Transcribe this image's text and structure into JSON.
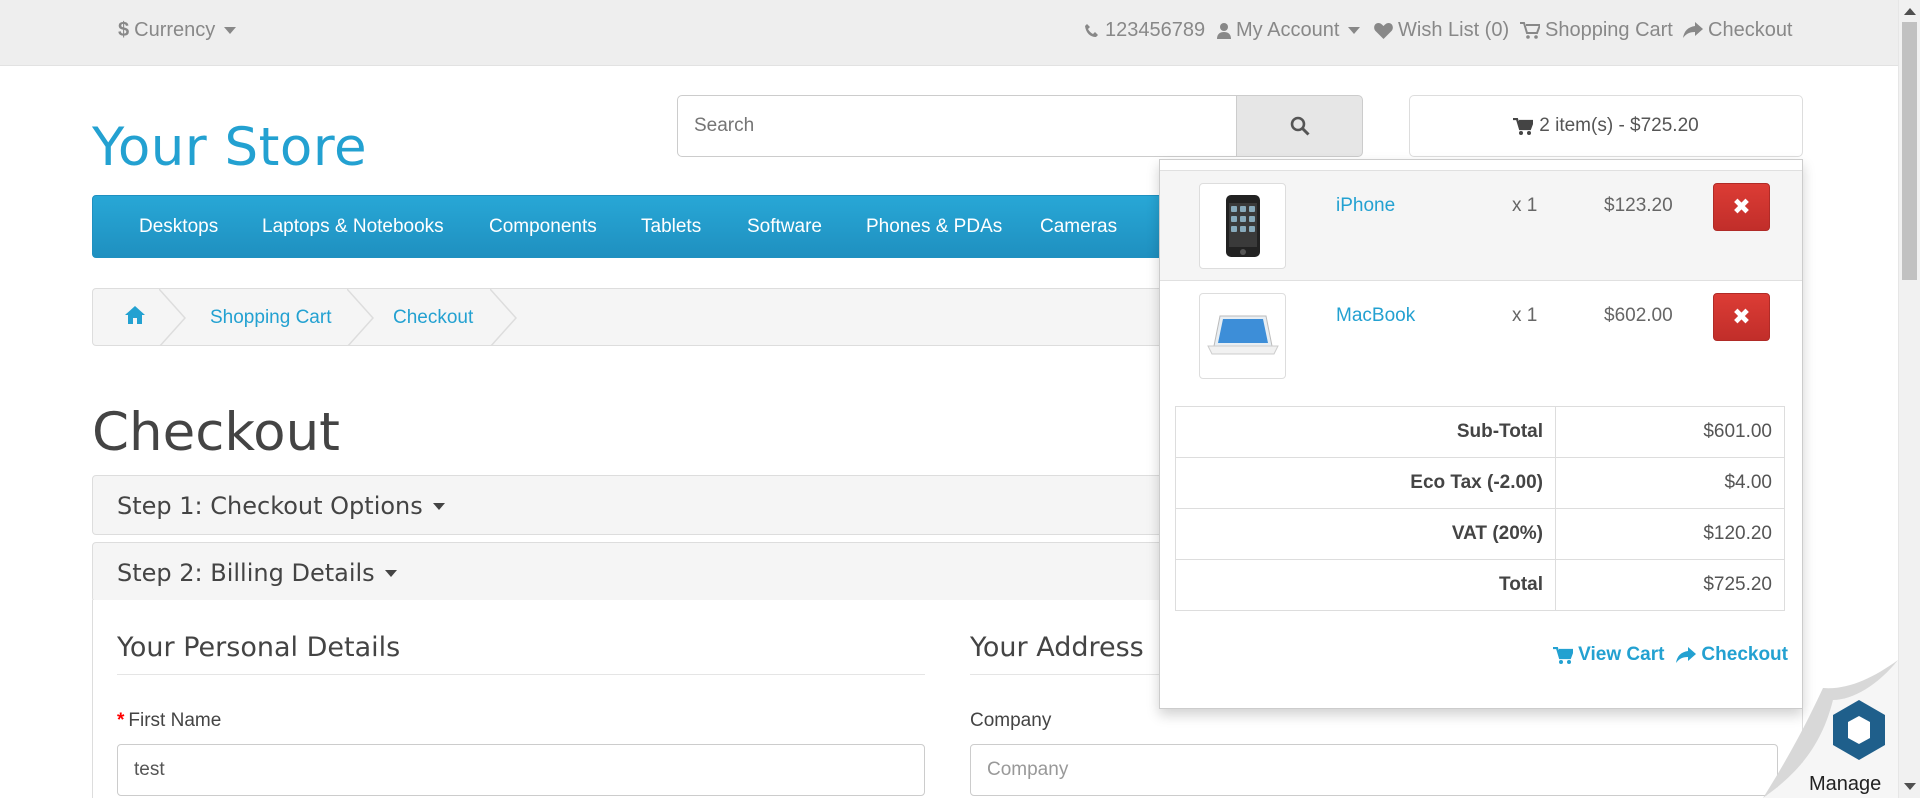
{
  "topbar": {
    "currency_label": "Currency",
    "phone": "123456789",
    "my_account": "My Account",
    "wish_list": "Wish List (0)",
    "shopping_cart": "Shopping Cart",
    "checkout": "Checkout"
  },
  "header": {
    "logo": "Your Store",
    "search_placeholder": "Search",
    "cart_summary": "2 item(s) - $725.20"
  },
  "menu": [
    "Desktops",
    "Laptops & Notebooks",
    "Components",
    "Tablets",
    "Software",
    "Phones & PDAs",
    "Cameras"
  ],
  "breadcrumb": [
    "Shopping Cart",
    "Checkout"
  ],
  "checkout": {
    "title": "Checkout",
    "step1": "Step 1: Checkout Options",
    "step2": "Step 2: Billing Details",
    "personal_details": "Your Personal Details",
    "your_address": "Your Address",
    "first_name_label": "First Name",
    "first_name_value": "test",
    "company_label": "Company",
    "company_placeholder": "Company"
  },
  "cart_dropdown": {
    "items": [
      {
        "name": "iPhone",
        "qty": "x 1",
        "price": "$123.20",
        "icon": "iphone-image"
      },
      {
        "name": "MacBook",
        "qty": "x 1",
        "price": "$602.00",
        "icon": "macbook-image"
      }
    ],
    "totals": [
      {
        "label": "Sub-Total",
        "value": "$601.00"
      },
      {
        "label": "Eco Tax (-2.00)",
        "value": "$4.00"
      },
      {
        "label": "VAT (20%)",
        "value": "$120.20"
      },
      {
        "label": "Total",
        "value": "$725.20"
      }
    ],
    "view_cart": "View Cart",
    "checkout": "Checkout"
  },
  "manage_widget": {
    "label": "Manage"
  },
  "colors": {
    "accent": "#23a1d1",
    "danger": "#d9534f",
    "menu": "#229ac8"
  }
}
